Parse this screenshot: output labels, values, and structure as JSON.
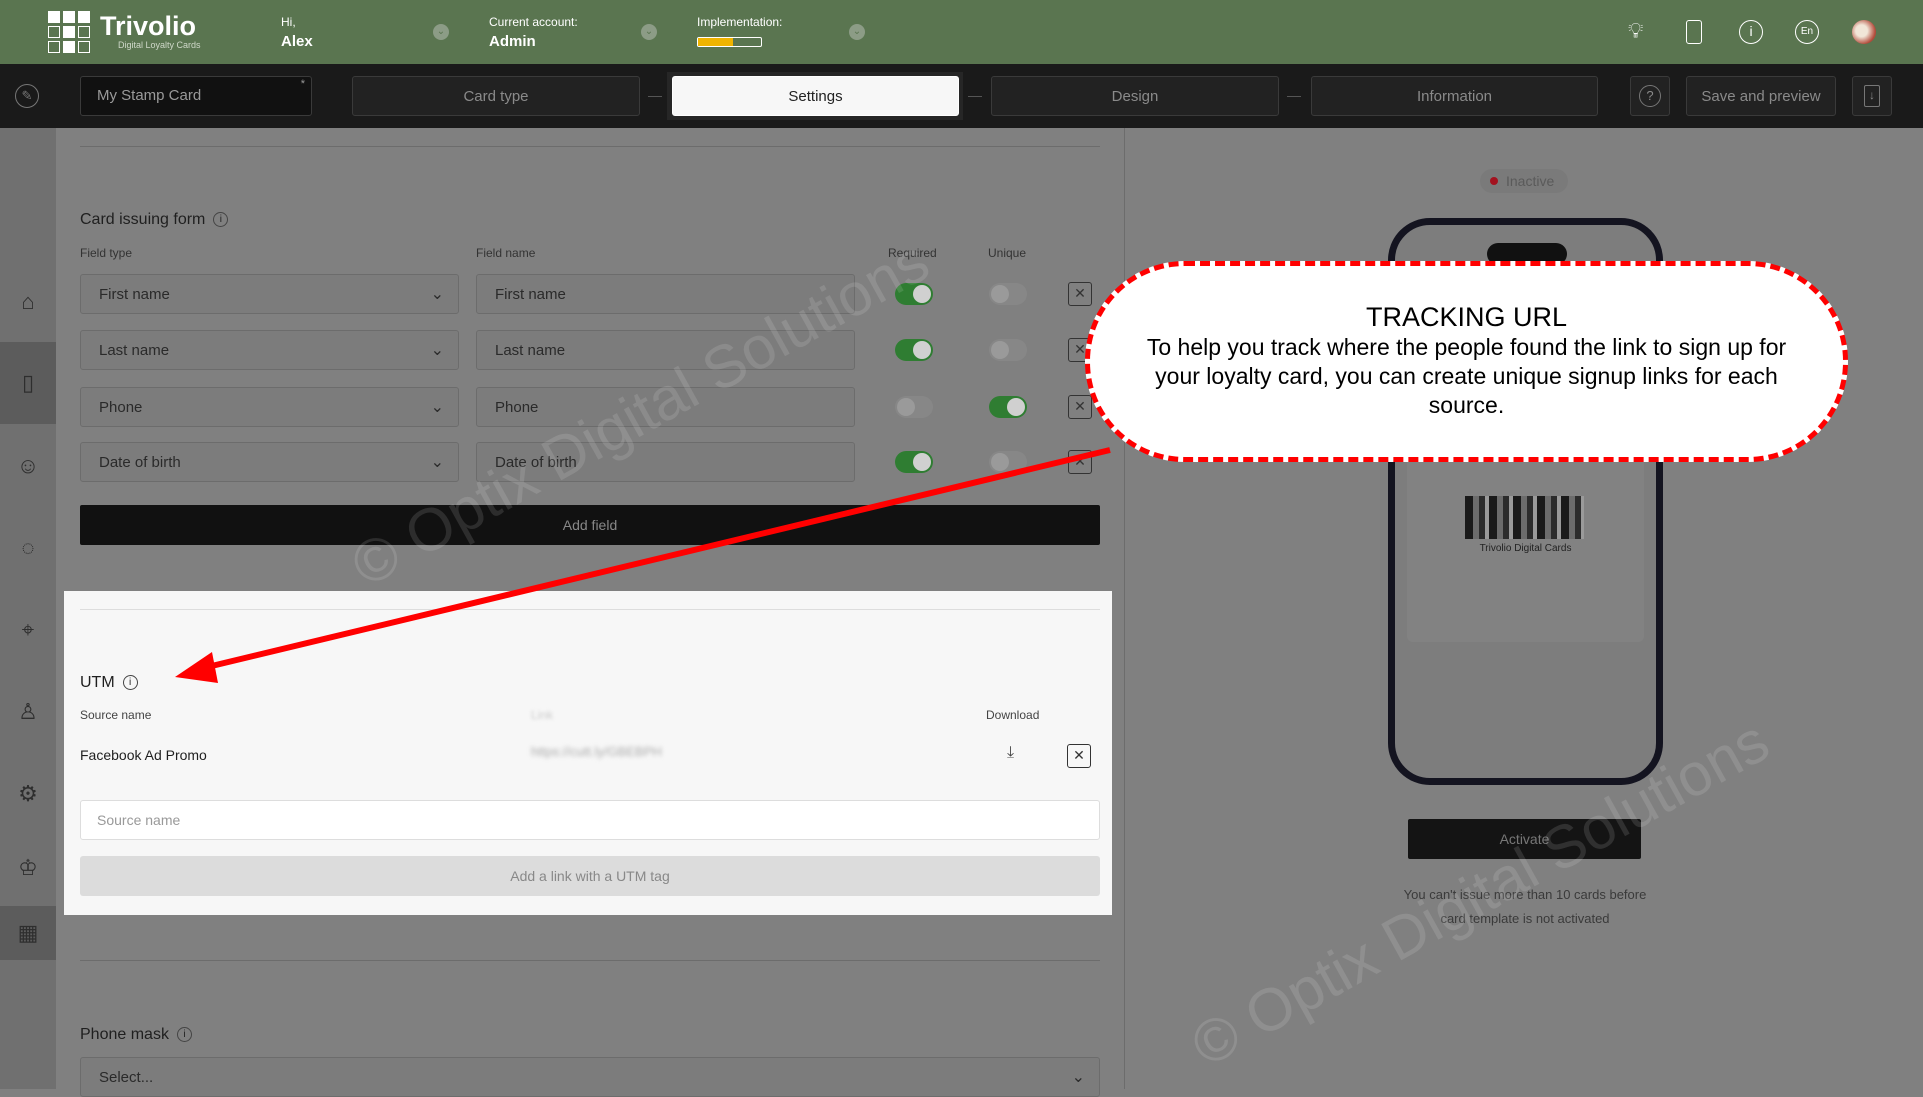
{
  "header": {
    "logo_title": "Trivolio",
    "logo_subtitle": "Digital Loyalty Cards",
    "greeting": "Hi,",
    "user": "Alex",
    "account_label": "Current account:",
    "account": "Admin",
    "implementation_label": "Implementation:",
    "implementation_progress": 0.55,
    "lang": "En"
  },
  "toolbar": {
    "card_name": "My Stamp Card",
    "tabs": [
      "Card type",
      "Settings",
      "Design",
      "Information"
    ],
    "active_tab": "Settings",
    "save_preview": "Save and preview"
  },
  "form": {
    "title": "Card issuing form",
    "col_field_type": "Field type",
    "col_field_name": "Field name",
    "col_required": "Required",
    "col_unique": "Unique",
    "rows": [
      {
        "type": "First name",
        "name": "First name",
        "required": true,
        "unique": false
      },
      {
        "type": "Last name",
        "name": "Last name",
        "required": true,
        "unique": false
      },
      {
        "type": "Phone",
        "name": "Phone",
        "required": false,
        "unique": true
      },
      {
        "type": "Date of birth",
        "name": "Date of birth",
        "required": true,
        "unique": false
      }
    ],
    "add_field": "Add field"
  },
  "utm": {
    "title": "UTM",
    "col_source": "Source name",
    "col_link": "Link",
    "col_download": "Download",
    "rows": [
      {
        "source": "Facebook Ad Promo",
        "link": "https://cutt.ly/GBEBPH"
      }
    ],
    "input_placeholder": "Source name",
    "add_button": "Add a link with a UTM tag"
  },
  "phone_mask": {
    "title": "Phone mask",
    "placeholder": "Select..."
  },
  "preview": {
    "status": "Inactive",
    "status_color": "#c0142a",
    "card_brand": "Trivolio Digital Cards",
    "activate": "Activate",
    "note_line1": "You can't issue more than 10 cards before",
    "note_line2": "card template is not activated"
  },
  "callout": {
    "title": "TRACKING URL",
    "body": "To help you track where the people found the link to sign up for your loyalty card, you can create unique signup links for each source."
  },
  "watermark": "© Optix Digital Solutions"
}
